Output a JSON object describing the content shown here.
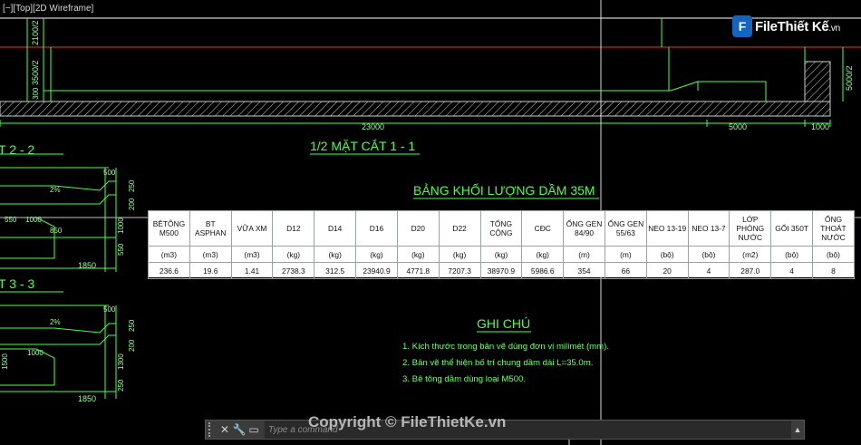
{
  "viewport": {
    "label": "[−][Top][2D Wireframe]"
  },
  "logo": {
    "brand_a": "File",
    "brand_b": "Thiết Kế",
    "suffix": ".vn"
  },
  "drawing": {
    "section_1_1_title": "1/2 MẶT CẮT 1 - 1",
    "section_2_2_title": "T 2 - 2",
    "section_3_3_title": "T 3 - 3",
    "dims_top": [
      "23000",
      "5000",
      "1000"
    ],
    "dims_vertical_left": [
      "2100/2",
      "3500/2",
      "300"
    ],
    "dims_vertical_right": [
      "5000/2"
    ],
    "dims_section2": [
      "500",
      "2%",
      "550",
      "1000",
      "850",
      "1850",
      "550",
      "1000",
      "200",
      "250"
    ],
    "dims_section3": [
      "500",
      "2%",
      "1000",
      "1500",
      "1300",
      "1850",
      "200",
      "250",
      "250"
    ]
  },
  "table": {
    "title": "BẢNG KHỐI LƯỢNG DẦM 35M",
    "headers": [
      "BÊTÔNG M500",
      "BT ASPHAN",
      "VỮA XM",
      "D12",
      "D14",
      "D16",
      "D20",
      "D22",
      "TỔNG CỘNG",
      "CĐC",
      "ỐNG GEN 84/90",
      "ỐNG GEN 55/63",
      "NEO 13-19",
      "NEO 13-7",
      "LỚP PHÒNG NƯỚC",
      "GỐI 350T",
      "ỐNG THOÁT NƯỚC"
    ],
    "units": [
      "(m3)",
      "(m3)",
      "(m3)",
      "(kg)",
      "(kg)",
      "(kg)",
      "(kg)",
      "(kg)",
      "(kg)",
      "(kg)",
      "(m)",
      "(m)",
      "(bộ)",
      "(bộ)",
      "(m2)",
      "(bộ)",
      "(bộ)"
    ],
    "values": [
      "236.6",
      "19.6",
      "1.41",
      "2738.3",
      "312.5",
      "23940.9",
      "4771.8",
      "7207.3",
      "38970.9",
      "5986.6",
      "354",
      "66",
      "20",
      "4",
      "287.0",
      "4",
      "8"
    ]
  },
  "notes": {
    "title": "GHI CHÚ",
    "items": [
      "1. Kích thước trong bản vẽ dùng đơn vị milimét (mm).",
      "2. Bản vẽ thể hiện bố trí chung dầm dài L=35.0m.",
      "3. Bê tông dầm dùng loại M500."
    ]
  },
  "command_line": {
    "placeholder": "Type a command"
  },
  "watermark": "Copyright © FileThietKe.vn"
}
